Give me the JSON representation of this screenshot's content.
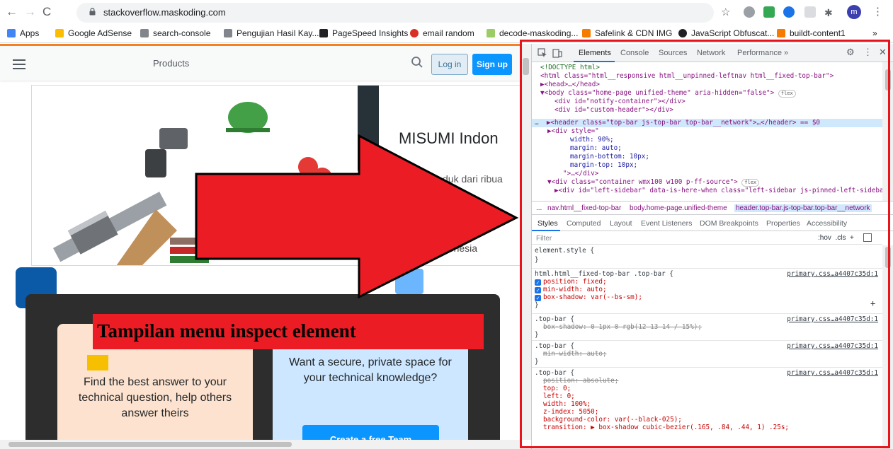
{
  "browser": {
    "url": "stackoverflow.maskoding.com",
    "profile_initial": "m",
    "bookmarks": [
      {
        "label": "Apps",
        "color": "#4285f4"
      },
      {
        "label": "Google AdSense",
        "color": "#fbbc04"
      },
      {
        "label": "search-console",
        "color": "#5f6368"
      },
      {
        "label": "Pengujian Hasil Kay...",
        "color": "#5f6368"
      },
      {
        "label": "PageSpeed Insights",
        "color": "#1a1a1a"
      },
      {
        "label": "email random",
        "color": "#d93025"
      },
      {
        "label": "decode-maskoding...",
        "color": "#9ccc65"
      },
      {
        "label": "Safelink & CDN IMG",
        "color": "#f57c00"
      },
      {
        "label": "JavaScript Obfuscat...",
        "color": "#202124"
      },
      {
        "label": "buildt-content1",
        "color": "#f57c00"
      }
    ],
    "more_bookmarks": "»"
  },
  "page": {
    "products_label": "Products",
    "login_label": "Log in",
    "signup_label": "Sign up",
    "ad_title": "MISUMI Indon",
    "ad_subtitle": "duk dari ribua",
    "ad_footer": "donesia",
    "card_left_text": "Find the best answer to your technical question, help others answer theirs",
    "card_right_text": "Want a secure, private space for your technical knowledge?",
    "create_team_label": "Create a free Team"
  },
  "annotation": {
    "caption": "Tampilan menu inspect element",
    "color": "#ec1c24"
  },
  "devtools": {
    "tabs": [
      "Elements",
      "Console",
      "Sources",
      "Network",
      "Performance",
      "»"
    ],
    "dom_lines": [
      "<!DOCTYPE html>",
      "<html class=\"html__responsive html__unpinned-leftnav html__fixed-top-bar\">",
      "▶<head>…</head>",
      "▼<body class=\"home-page unified-theme\" aria-hidden=\"false\">",
      "<div id=\"notify-container\"></div>",
      "<div id=\"custom-header\"></div>",
      "▶<header class=\"top-bar js-top-bar top-bar__network\">…</header> == $0",
      "▶<div style=\"",
      "width: 90%;",
      "margin: auto;",
      "margin-bottom: 10px;",
      "margin-top: 10px;",
      "\">…</div>",
      "▼<div class=\"container wmx100 w100 p-ff-source\">",
      "▶<div id=\"left-sidebar\" data-is-here-when class=\"left-sidebar js-pinned-left-sideba"
    ],
    "flex_badge": "flex",
    "breadcrumbs": [
      "...",
      "nav.html__fixed-top-bar",
      "body.home-page.unified-theme",
      "header.top-bar.js-top-bar.top-bar__network"
    ],
    "sub_tabs": [
      "Styles",
      "Computed",
      "Layout",
      "Event Listeners",
      "DOM Breakpoints",
      "Properties",
      "Accessibility"
    ],
    "filter_placeholder": "Filter",
    "filter_controls": ":hov  .cls  +",
    "styles": {
      "element_style": "element.style {",
      "rule1_selector": "html.html__fixed-top-bar .top-bar {",
      "rule1_props": [
        "position: fixed;",
        "min-width: auto;",
        "box-shadow: var(--bs-sm);"
      ],
      "rule2_selector": ".top-bar {",
      "rule2_prop": "box-shadow: 0 1px 0 rgb(12 13 14 / 15%);",
      "rule3_selector": ".top-bar {",
      "rule3_prop": "min-width: auto;",
      "rule4_selector": ".top-bar {",
      "rule4_props": [
        "position: absolute;",
        "top: 0;",
        "left: 0;",
        "width: 100%;",
        "z-index: 5050;",
        "background-color: var(--black-025);",
        "transition: ▶ box-shadow cubic-bezier(.165, .84, .44, 1) .25s;"
      ],
      "source": "primary.css…a4407c35d:1",
      "close_brace": "}",
      "plus": "+"
    }
  }
}
